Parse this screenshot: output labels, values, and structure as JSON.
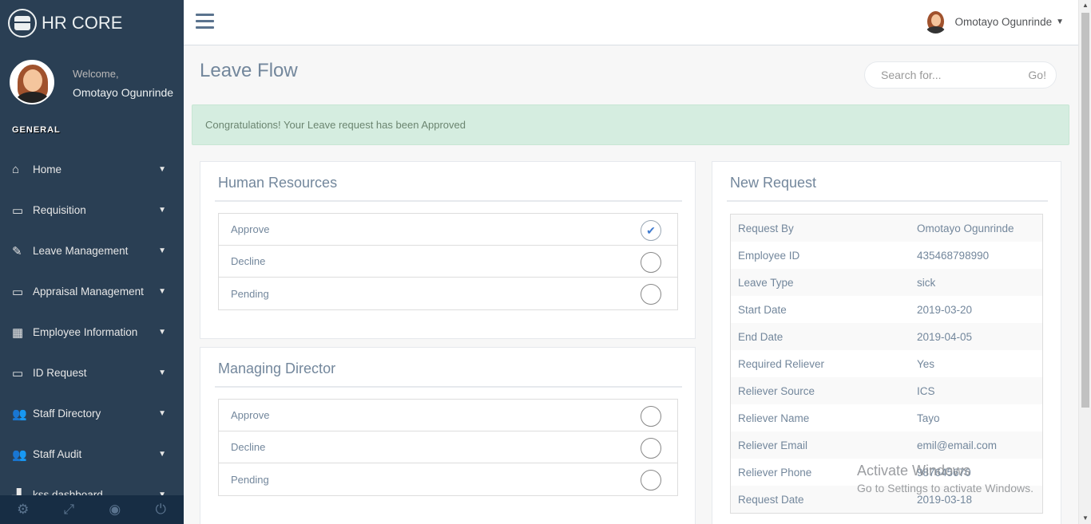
{
  "brand": {
    "title": "HR CORE"
  },
  "profile": {
    "welcome": "Welcome,",
    "name": "Omotayo Ogunrinde"
  },
  "sidebar": {
    "section": "GENERAL",
    "items": [
      {
        "label": "Home",
        "icon": "home-icon",
        "glyph": "⌂"
      },
      {
        "label": "Requisition",
        "icon": "desktop-icon",
        "glyph": "▭"
      },
      {
        "label": "Leave Management",
        "icon": "edit-icon",
        "glyph": "✎"
      },
      {
        "label": "Appraisal Management",
        "icon": "desktop-icon",
        "glyph": "▭"
      },
      {
        "label": "Employee Information",
        "icon": "table-icon",
        "glyph": "▦"
      },
      {
        "label": "ID Request",
        "icon": "desktop-icon",
        "glyph": "▭"
      },
      {
        "label": "Staff Directory",
        "icon": "users-icon",
        "glyph": "👥"
      },
      {
        "label": "Staff Audit",
        "icon": "users-icon",
        "glyph": "👥"
      },
      {
        "label": "kss dashboard",
        "icon": "bar-chart-icon",
        "glyph": "▟"
      }
    ],
    "footer": [
      {
        "icon": "settings-icon",
        "glyph": "⚙"
      },
      {
        "icon": "fullscreen-icon",
        "glyph": "⤢"
      },
      {
        "icon": "eye-slash-icon",
        "glyph": "◉"
      },
      {
        "icon": "power-icon",
        "glyph": "⏻"
      }
    ]
  },
  "topnav": {
    "user_name": "Omotayo Ogunrinde"
  },
  "page": {
    "title": "Leave Flow",
    "search_placeholder": "Search for...",
    "search_go": "Go!",
    "alert": "Congratulations! Your Leave request has been Approved"
  },
  "hr_panel": {
    "title": "Human Resources",
    "options": [
      {
        "label": "Approve",
        "checked": true
      },
      {
        "label": "Decline",
        "checked": false
      },
      {
        "label": "Pending",
        "checked": false
      }
    ]
  },
  "md_panel": {
    "title": "Managing Director",
    "options": [
      {
        "label": "Approve",
        "checked": false
      },
      {
        "label": "Decline",
        "checked": false
      },
      {
        "label": "Pending",
        "checked": false
      }
    ]
  },
  "request_panel": {
    "title": "New Request",
    "rows": [
      {
        "key": "Request By",
        "value": "Omotayo Ogunrinde"
      },
      {
        "key": "Employee ID",
        "value": "435468798990"
      },
      {
        "key": "Leave Type",
        "value": "sick"
      },
      {
        "key": "Start Date",
        "value": "2019-03-20"
      },
      {
        "key": "End Date",
        "value": "2019-04-05"
      },
      {
        "key": "Required Reliever",
        "value": "Yes"
      },
      {
        "key": "Reliever Source",
        "value": "ICS"
      },
      {
        "key": "Reliever Name",
        "value": "Tayo"
      },
      {
        "key": "Reliever Email",
        "value": "emil@email.com"
      },
      {
        "key": "Reliever Phone",
        "value": "987645670"
      },
      {
        "key": "Request Date",
        "value": "2019-03-18"
      }
    ]
  },
  "watermark": {
    "line1": "Activate Windows",
    "line2": "Go to Settings to activate Windows."
  },
  "colors": {
    "sidebar": "#2a3f54",
    "sidebar_footer": "#172d44",
    "alert_bg": "#d5ede0",
    "text": "#73879c"
  }
}
